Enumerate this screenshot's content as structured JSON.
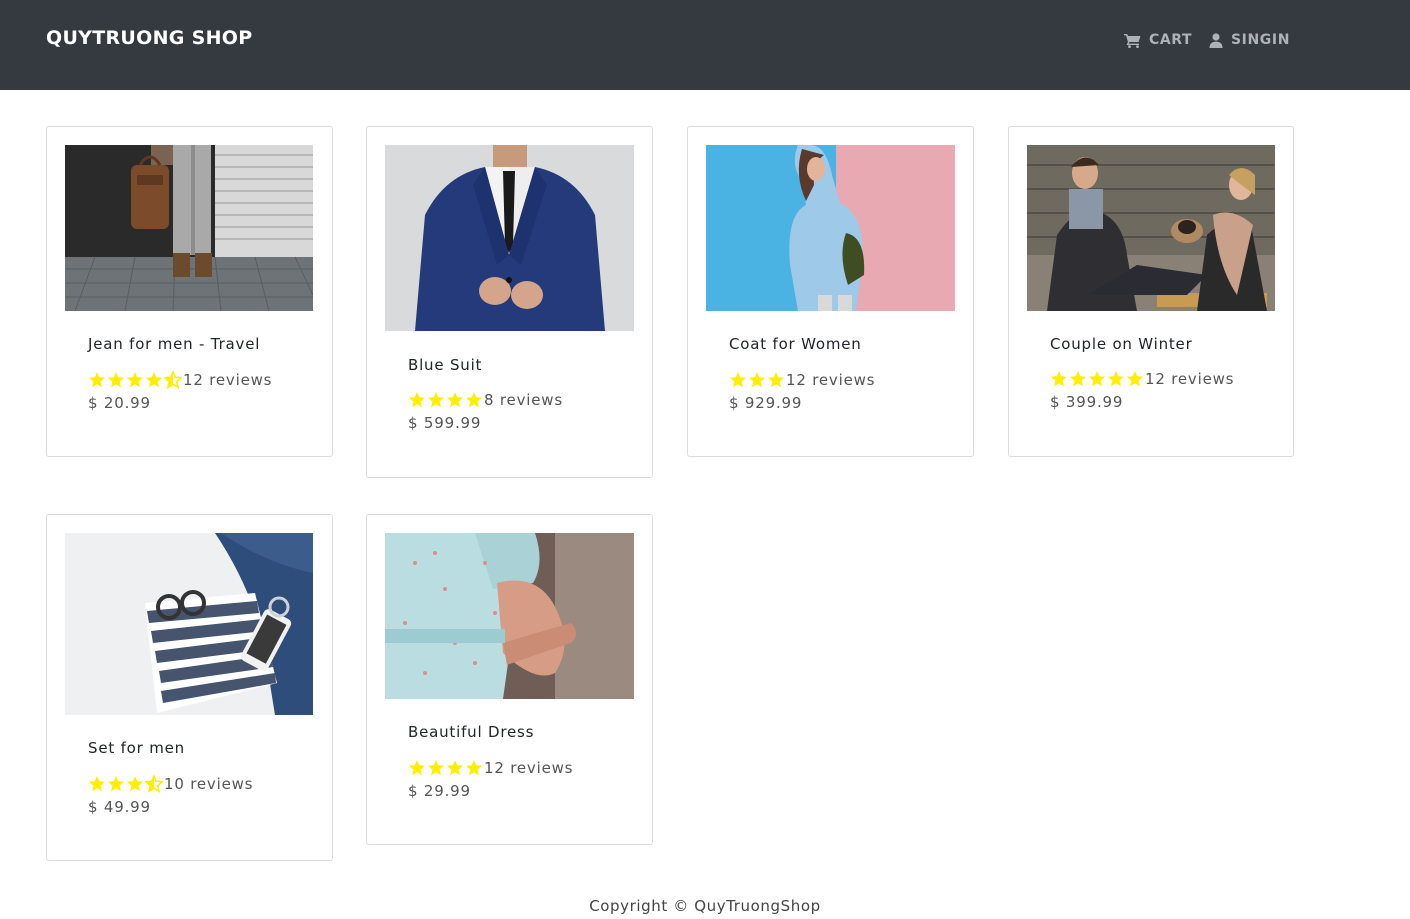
{
  "navbar": {
    "brand": "QUYTRUONG SHOP",
    "cart_label": "CART",
    "signin_label": "SINGIN",
    "background": "#343a40",
    "link_color": "#aeb2b7"
  },
  "products": [
    {
      "name": "Jean for men - Travel",
      "rating": 4.5,
      "reviews": "12 reviews",
      "price": "$ 20.99",
      "image_icon": "man-with-bag-photo"
    },
    {
      "name": "Blue Suit",
      "rating": 4,
      "reviews": "8 reviews",
      "price": "$ 599.99",
      "image_icon": "blue-suit-photo"
    },
    {
      "name": "Coat for Women",
      "rating": 3,
      "reviews": "12 reviews",
      "price": "$ 929.99",
      "image_icon": "woman-denim-coat-photo"
    },
    {
      "name": "Couple on Winter",
      "rating": 5,
      "reviews": "12 reviews",
      "price": "$ 399.99",
      "image_icon": "couple-winter-photo"
    },
    {
      "name": "Set for men",
      "rating": 3.5,
      "reviews": "10 reviews",
      "price": "$ 49.99",
      "image_icon": "clothing-set-photo"
    },
    {
      "name": "Beautiful Dress",
      "rating": 4,
      "reviews": "12 reviews",
      "price": "$ 29.99",
      "image_icon": "floral-dress-photo"
    }
  ],
  "star_color": "#ffee00",
  "footer": {
    "copyright": "Copyright © QuyTruongShop"
  }
}
